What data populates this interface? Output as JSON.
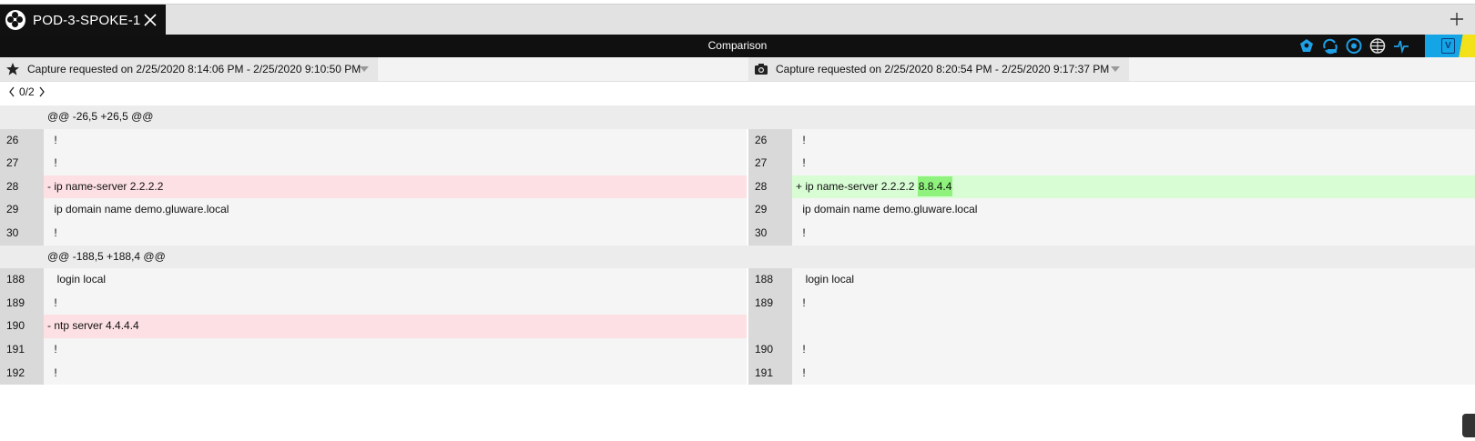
{
  "tab": {
    "title": "POD-3-SPOKE-1",
    "icon": "gluware-logo-icon"
  },
  "header": {
    "title": "Comparison",
    "icons": [
      "topology-icon",
      "sync-icon",
      "eye-icon",
      "globe-icon",
      "pulse-icon"
    ],
    "brand": "V",
    "colors": {
      "bar": "#101010",
      "accent_blue": "#14a5e6",
      "accent_yellow": "#f3e11a"
    }
  },
  "captures": {
    "left": {
      "icon": "star-icon",
      "label": "Capture requested on 2/25/2020 8:14:06 PM - 2/25/2020 9:10:50 PM"
    },
    "right": {
      "icon": "camera-icon",
      "label": "Capture requested on 2/25/2020 8:20:54 PM - 2/25/2020 9:17:37 PM"
    }
  },
  "nav": {
    "counter": "0/2"
  },
  "diff": {
    "hunks": [
      {
        "header": "@@ -26,5 +26,5 @@",
        "rows": [
          {
            "l_num": "26",
            "l_text": " !",
            "l_type": "ctx",
            "r_num": "26",
            "r_text": " !",
            "r_type": "ctx"
          },
          {
            "l_num": "27",
            "l_text": " !",
            "l_type": "ctx",
            "r_num": "27",
            "r_text": " !",
            "r_type": "ctx"
          },
          {
            "l_num": "28",
            "l_text": "- ip name-server 2.2.2.2",
            "l_type": "del",
            "r_num": "28",
            "r_text": "+ ip name-server 2.2.2.2 ",
            "r_hl": "8.8.4.4",
            "r_type": "add"
          },
          {
            "l_num": "29",
            "l_text": " ip domain name demo.gluware.local",
            "l_type": "ctx",
            "r_num": "29",
            "r_text": " ip domain name demo.gluware.local",
            "r_type": "ctx"
          },
          {
            "l_num": "30",
            "l_text": " !",
            "l_type": "ctx",
            "r_num": "30",
            "r_text": " !",
            "r_type": "ctx"
          }
        ]
      },
      {
        "header": "@@ -188,5 +188,4 @@",
        "rows": [
          {
            "l_num": "188",
            "l_text": "  login local",
            "l_type": "ctx",
            "r_num": "188",
            "r_text": "  login local",
            "r_type": "ctx"
          },
          {
            "l_num": "189",
            "l_text": " !",
            "l_type": "ctx",
            "r_num": "189",
            "r_text": " !",
            "r_type": "ctx"
          },
          {
            "l_num": "190",
            "l_text": "- ntp server 4.4.4.4",
            "l_type": "del",
            "r_num": "",
            "r_text": "",
            "r_type": "empty"
          },
          {
            "l_num": "191",
            "l_text": " !",
            "l_type": "ctx",
            "r_num": "190",
            "r_text": " !",
            "r_type": "ctx"
          },
          {
            "l_num": "192",
            "l_text": " !",
            "l_type": "ctx",
            "r_num": "191",
            "r_text": " !",
            "r_type": "ctx"
          }
        ]
      }
    ]
  }
}
